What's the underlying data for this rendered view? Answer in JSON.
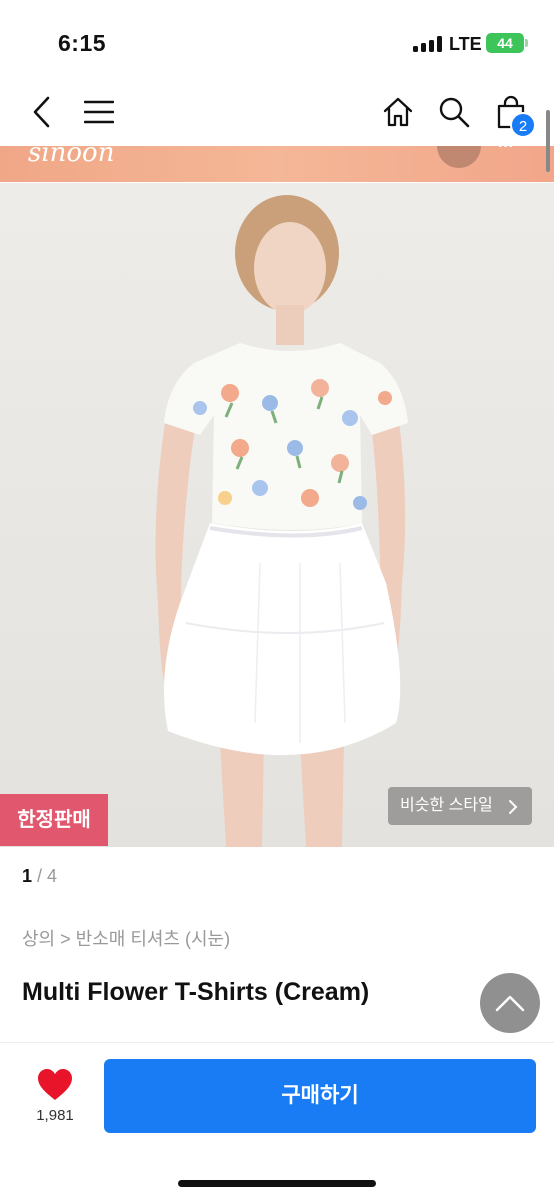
{
  "status_bar": {
    "time": "6:15",
    "network": "LTE",
    "battery": "44"
  },
  "nav": {
    "cart_count": "2"
  },
  "image": {
    "limited_badge": "한정판매",
    "similar_style": "비슷한 스타일"
  },
  "pager": {
    "current": "1",
    "total": "/ 4"
  },
  "breadcrumb": "상의 > 반소매 티셔츠 (시눈)",
  "product": {
    "title": "Multi Flower T-Shirts (Cream)"
  },
  "bottom": {
    "like_count": "1,981",
    "buy_label": "구매하기"
  },
  "colors": {
    "accent": "#1a7cf5",
    "limited": "#e0576e",
    "like": "#e8152a"
  }
}
